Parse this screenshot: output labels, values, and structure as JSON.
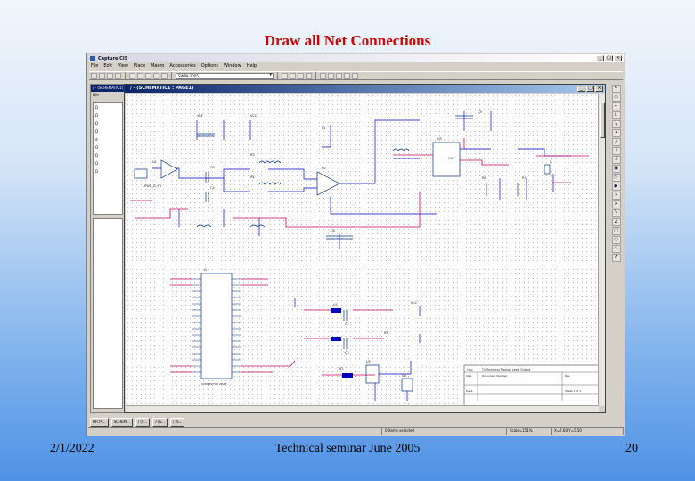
{
  "slide": {
    "title": "Draw all Net Connections",
    "date": "2/1/2022",
    "footer_text": "Technical seminar June 2005",
    "page_number": "20"
  },
  "app": {
    "window_title": "Capture CIS",
    "menu": [
      "File",
      "Edit",
      "View",
      "Place",
      "Macro",
      "Accessories",
      "Options",
      "Window",
      "Help"
    ],
    "part_combo_value": "SWPA-2005"
  },
  "project": {
    "header": "/ - (SCHEMATIC1)",
    "tab_label": "File",
    "tree_items": [
      "D",
      "D",
      "D",
      "D",
      "d",
      "O",
      "D",
      "O",
      "D"
    ]
  },
  "schematic": {
    "window_title": "/ - (SCHEMATIC1 : PAGE1)",
    "labels": {
      "u1": "U1",
      "u2": "U2",
      "u3": "U3",
      "u5": "U5",
      "u6": "U6",
      "u7": "U7",
      "r1": "R1",
      "r2": "R2",
      "r3": "R3",
      "r4": "R4",
      "r5": "R5",
      "r6": "R6",
      "r7": "R7",
      "c1": "C1",
      "c2": "C2",
      "c3": "C3",
      "c4": "C4",
      "c5": "C5",
      "c6": "C6",
      "vcc": "VCC",
      "vcc2": "VCC",
      "vee": "VEE",
      "out": "OUT",
      "j1": "J1",
      "d1_tag": "-PWR_D_NT",
      "ic_part": "CONNECTOR DB25",
      "conn_label": "J2",
      "title_block_title": "TI/ Technical Product Level Output",
      "title_block_size": "Size",
      "title_block_docnum": "Document Number",
      "title_block_date": "Date:",
      "title_block_rev": "Rev",
      "title_block_sheet": "Sheet 1 of 1"
    }
  },
  "taskbar": [
    "OR Pr...",
    "SCHEM...",
    "/ (S...",
    "/ (S...",
    "/ (S..."
  ],
  "status": {
    "message": "0 items selected",
    "scale": "Scale=151%",
    "coords": "X=7.60  Y=5.50"
  }
}
